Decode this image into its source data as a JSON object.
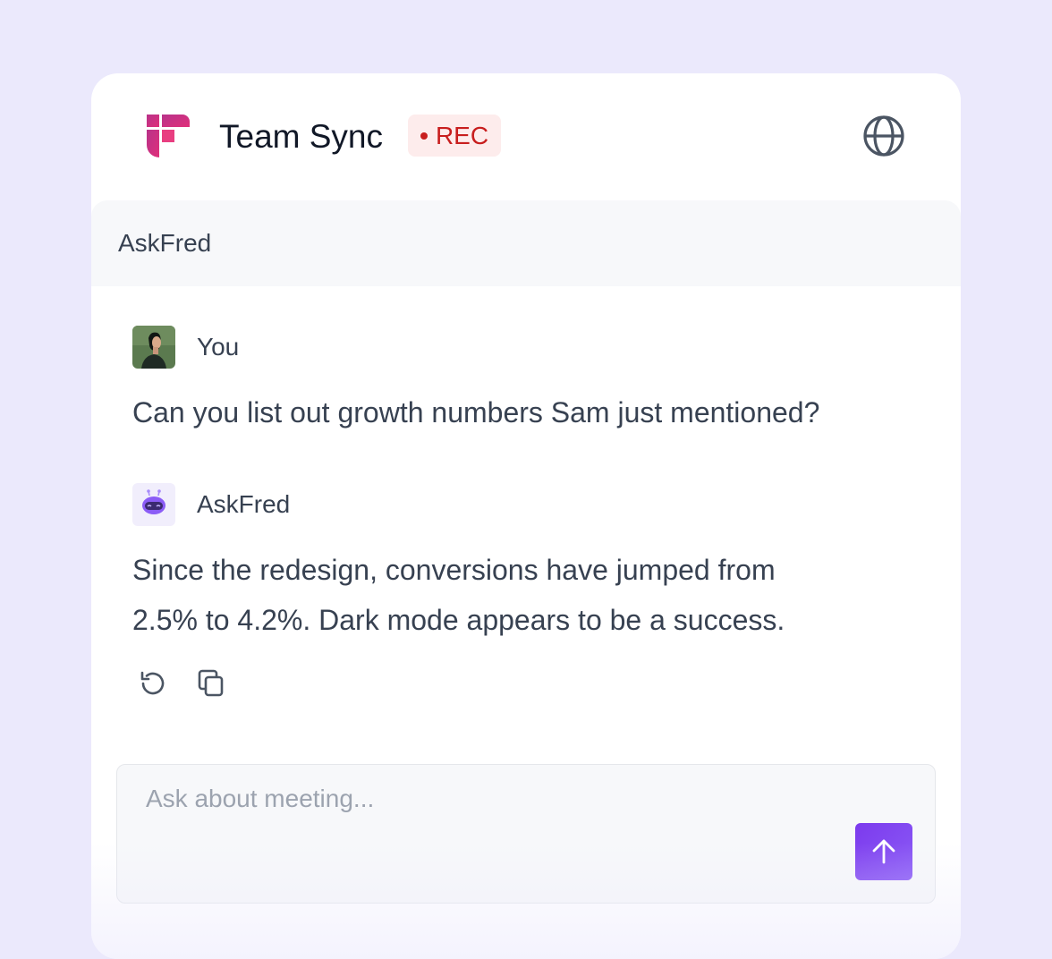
{
  "header": {
    "title": "Team Sync",
    "rec_label": "REC",
    "logo_icon": "fireflies-logo",
    "globe_icon": "globe-icon"
  },
  "panel": {
    "title": "AskFred"
  },
  "messages": [
    {
      "author": "You",
      "avatar": "user-photo-avatar",
      "text": "Can you list out growth numbers Sam just mentioned?"
    },
    {
      "author": "AskFred",
      "avatar": "robot-avatar",
      "text_line1": "Since the redesign, conversions have jumped from",
      "text_line2": "2.5% to 4.2%. Dark mode appears to be a success."
    }
  ],
  "actions": {
    "regenerate_icon": "refresh-icon",
    "copy_icon": "copy-icon"
  },
  "input": {
    "placeholder": "Ask about meeting...",
    "value": "",
    "send_icon": "arrow-up-icon"
  },
  "colors": {
    "background": "#ebe9fc",
    "accent": "#7c3aed",
    "rec_text": "#c81e1e",
    "rec_bg": "#fdecec",
    "logo_pink": "#e0307a"
  }
}
